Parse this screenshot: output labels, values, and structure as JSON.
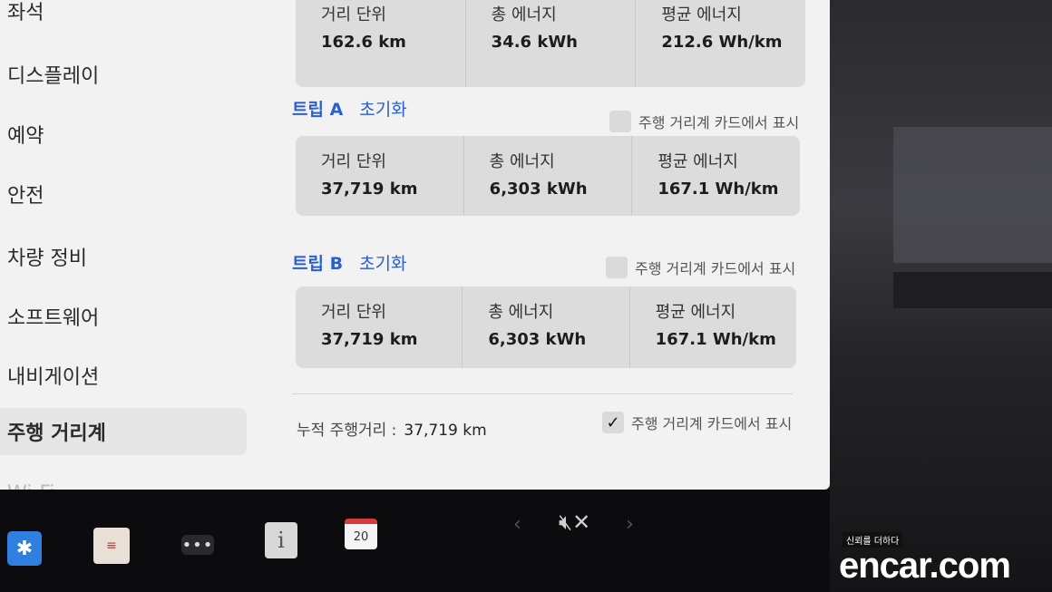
{
  "sidebar": {
    "items": [
      {
        "label": "좌석"
      },
      {
        "label": "디스플레이"
      },
      {
        "label": "예약"
      },
      {
        "label": "안전"
      },
      {
        "label": "차량 정비"
      },
      {
        "label": "소프트웨어"
      },
      {
        "label": "내비게이션"
      },
      {
        "label": "주행 거리계",
        "active": true
      },
      {
        "label": "Wi-Fi"
      }
    ]
  },
  "top_card": {
    "distance_label": "거리 단위",
    "distance_value": "162.6 km",
    "energy_label": "총 에너지",
    "energy_value": "34.6 kWh",
    "avg_label": "평균 에너지",
    "avg_value": "212.6 Wh/km"
  },
  "trip_a": {
    "title": "트립 A",
    "reset": "초기화",
    "show_on_card": "주행 거리계 카드에서 표시",
    "checked": false,
    "distance_label": "거리 단위",
    "distance_value": "37,719 km",
    "energy_label": "총 에너지",
    "energy_value": "6,303 kWh",
    "avg_label": "평균 에너지",
    "avg_value": "167.1 Wh/km"
  },
  "trip_b": {
    "title": "트립 B",
    "reset": "초기화",
    "show_on_card": "주행 거리계 카드에서 표시",
    "checked": false,
    "distance_label": "거리 단위",
    "distance_value": "37,719 km",
    "energy_label": "총 에너지",
    "energy_value": "6,303 kWh",
    "avg_label": "평균 에너지",
    "avg_value": "167.1 Wh/km"
  },
  "odometer": {
    "label": "누적 주행거리 :",
    "value": "37,719 km",
    "show_on_card": "주행 거리계 카드에서 표시",
    "checked": true,
    "check_glyph": "✓"
  },
  "taskbar": {
    "bluetooth_glyph": "✱",
    "notes_glyph": "≡",
    "dots_glyph": "•••",
    "info_glyph": "i",
    "calendar_day": "20",
    "left_arrow": "‹",
    "right_arrow": "›",
    "mute_glyph": "🔇︎✕"
  },
  "watermark": {
    "tag": "신뢰를 더하다",
    "brand": "encar.com"
  },
  "colors": {
    "accent": "#2b5fd0",
    "screen_bg": "#f2f2f2",
    "card_bg": "#dcdcdc"
  }
}
